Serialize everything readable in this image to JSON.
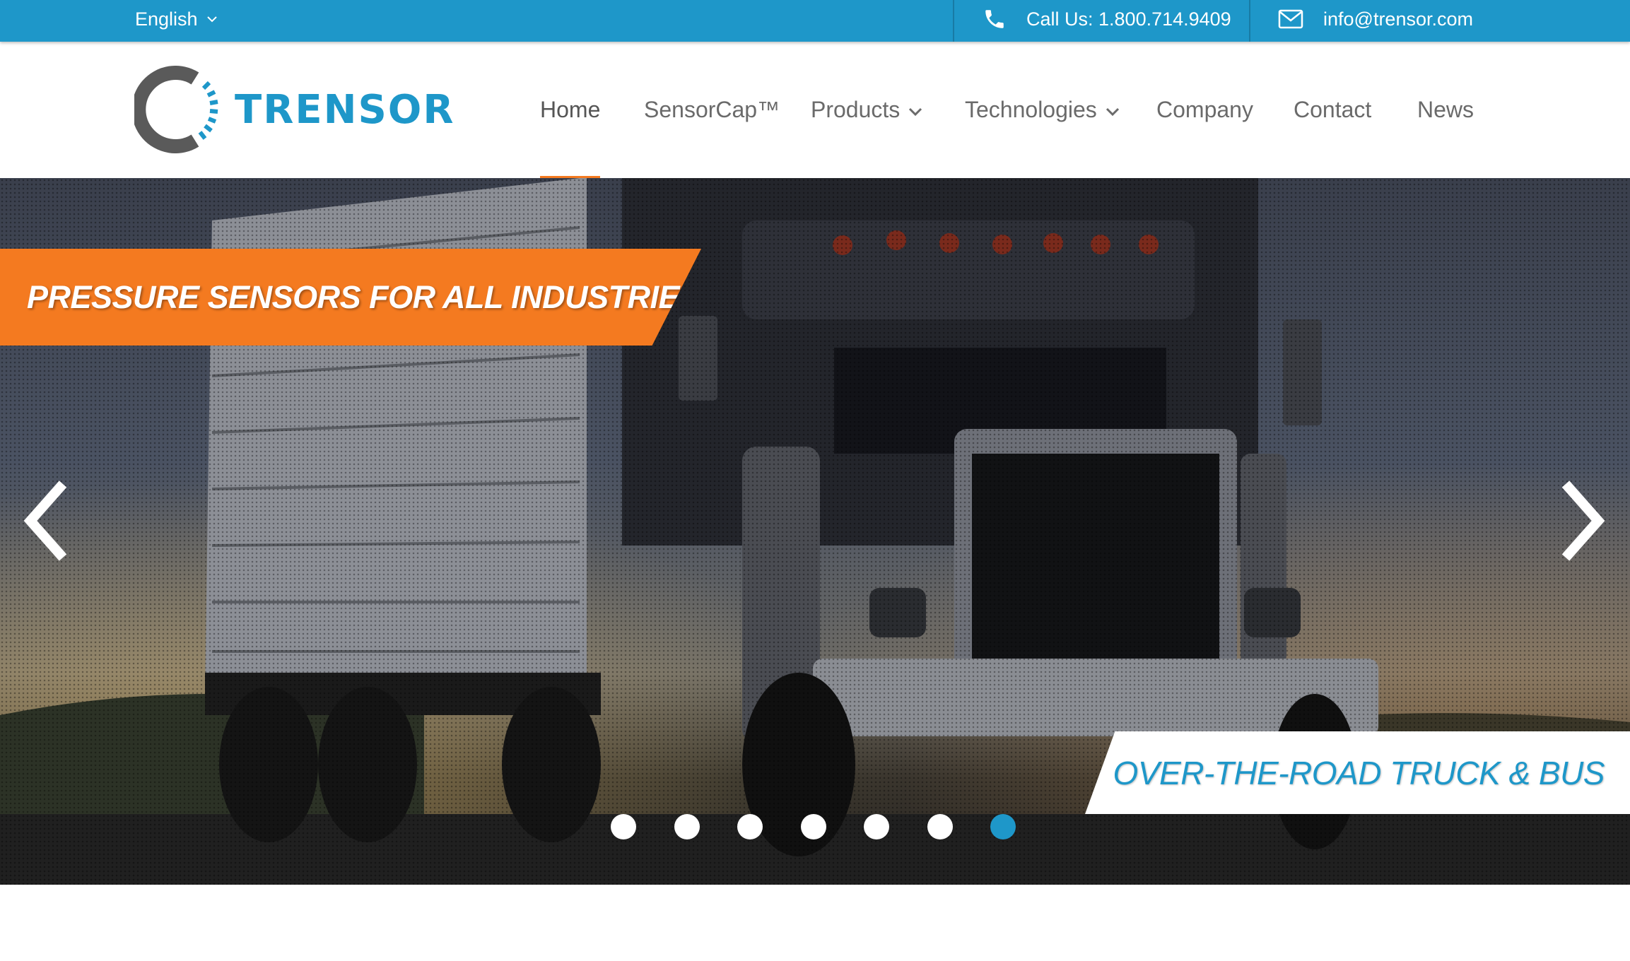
{
  "topbar": {
    "language": "English",
    "phone_label": "Call Us: 1.800.714.9409",
    "email_label": "info@trensor.com"
  },
  "header": {
    "logo_text": "TRENSOR",
    "nav": [
      {
        "label": "Home",
        "active": true,
        "dropdown": false
      },
      {
        "label": "SensorCap™",
        "active": false,
        "dropdown": false
      },
      {
        "label": "Products",
        "active": false,
        "dropdown": true
      },
      {
        "label": "Technologies",
        "active": false,
        "dropdown": true
      },
      {
        "label": "Company",
        "active": false,
        "dropdown": false
      },
      {
        "label": "Contact",
        "active": false,
        "dropdown": false
      },
      {
        "label": "News",
        "active": false,
        "dropdown": false
      }
    ]
  },
  "hero": {
    "headline": "PRESSURE SENSORS FOR ALL INDUSTRIES",
    "caption": "OVER-THE-ROAD TRUCK & BUS",
    "slide_count": 7,
    "active_slide": 6,
    "prev_icon": "chevron-left-icon",
    "next_icon": "chevron-right-icon"
  },
  "colors": {
    "brand_blue": "#1e97c9",
    "accent_orange": "#f47a20",
    "logo_gray": "#5a5a5a",
    "nav_text": "#6a6a6a"
  }
}
